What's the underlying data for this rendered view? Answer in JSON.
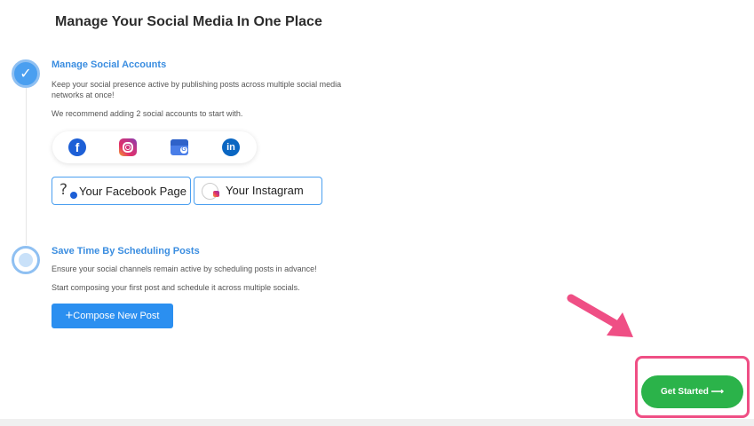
{
  "page": {
    "title": "Manage Your Social Media In One Place"
  },
  "steps": [
    {
      "title": "Manage Social Accounts",
      "description": "Keep your social presence active by publishing posts across multiple social media networks at once!",
      "note": "We recommend adding 2 social accounts to start with.",
      "status": "completed"
    },
    {
      "title": "Save Time By Scheduling Posts",
      "description": "Ensure your social channels remain active by scheduling posts in advance!",
      "note": "Start composing your first post and schedule it across multiple socials.",
      "status": "pending"
    }
  ],
  "social_networks": [
    {
      "name": "facebook",
      "icon": "facebook-icon",
      "color": "#1d5fd6"
    },
    {
      "name": "instagram",
      "icon": "instagram-icon",
      "color": "#e1306c"
    },
    {
      "name": "google-business",
      "icon": "google-business-icon",
      "color": "#4a7ee8"
    },
    {
      "name": "linkedin",
      "icon": "linkedin-icon",
      "color": "#0a66c2"
    }
  ],
  "accounts": {
    "facebook_label": "Your Facebook Page",
    "instagram_label": "Your Instagram"
  },
  "buttons": {
    "compose": "Compose New Post",
    "get_started": "Get Started ⟶"
  },
  "colors": {
    "accent": "#2b8ff0",
    "success": "#2bb34a",
    "highlight": "#ef4f85"
  }
}
